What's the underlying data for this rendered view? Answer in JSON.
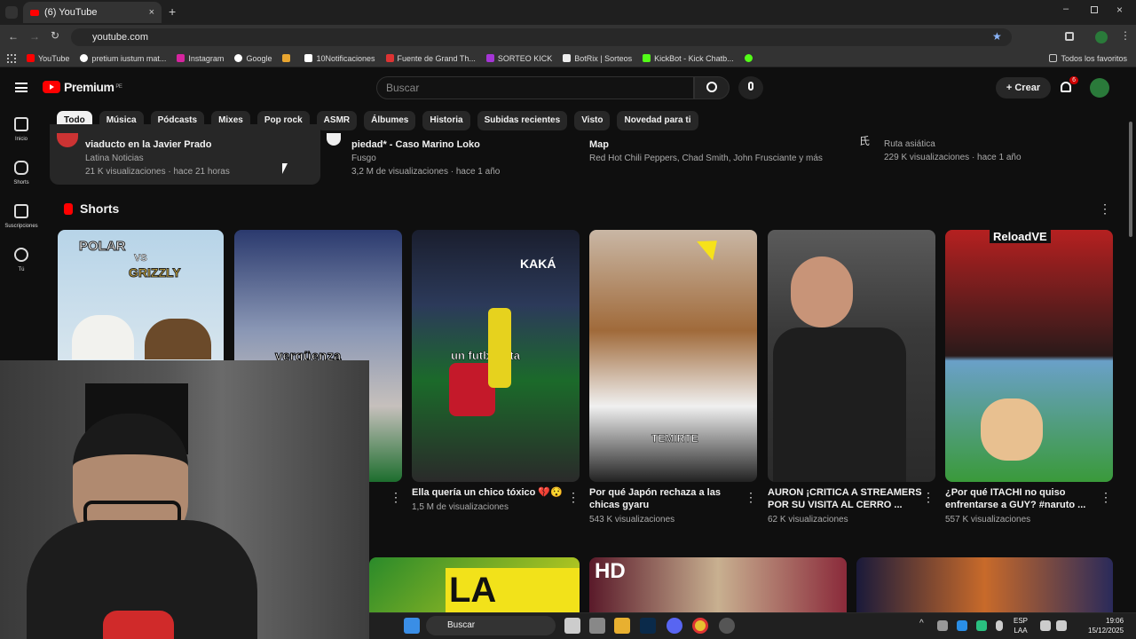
{
  "browser": {
    "tab_title": "(6) YouTube",
    "url": "youtube.com",
    "bookmarks": [
      "YouTube",
      "pretium iustum mat...",
      "Instagram",
      "Google",
      "",
      "10Notificaciones",
      "Fuente de Grand Th...",
      "SORTEO KICK",
      "BotRix | Sorteos",
      "KickBot - Kick Chatb...",
      "",
      ""
    ],
    "all_bookmarks": "Todos los favoritos"
  },
  "youtube": {
    "logo_text": "Premium",
    "logo_region": "PE",
    "search_placeholder": "Buscar",
    "create_label": "Crear",
    "notification_count": "6",
    "chips": [
      "Todo",
      "Música",
      "Pódcasts",
      "Mixes",
      "Pop rock",
      "ASMR",
      "Álbumes",
      "Historia",
      "Subidas recientes",
      "Visto",
      "Novedad para ti"
    ],
    "sidebar": [
      {
        "label": "Inicio",
        "icon": "home-icon"
      },
      {
        "label": "Shorts",
        "icon": "shorts-icon"
      },
      {
        "label": "Suscripciones",
        "icon": "subscriptions-icon"
      },
      {
        "label": "Tú",
        "icon": "user-icon"
      }
    ],
    "videos": [
      {
        "title": "viaducto en la Javier Prado",
        "channel": "Latina Noticias",
        "meta": "21 K visualizaciones · hace 21 horas"
      },
      {
        "title": "piedad* - Caso Marino Loko",
        "channel": "Fusgo",
        "meta": "3,2 M de visualizaciones · hace 1 año"
      },
      {
        "title": "Map",
        "channel": "Red Hot Chili Peppers, Chad Smith, John Frusciante y más",
        "meta": ""
      },
      {
        "title": "",
        "channel": "Ruta asiática",
        "meta": "229 K visualizaciones · hace 1 año"
      }
    ],
    "shorts_title": "Shorts",
    "shorts": [
      {
        "overlay": "POLAR",
        "overlay2": "VS",
        "overlay3": "GRIZZLY",
        "title": "",
        "views": ""
      },
      {
        "overlay": "vergüenza",
        "title": "",
        "views": ""
      },
      {
        "overlay": "KAKÁ",
        "overlay2": "un futbolista",
        "title": "Ella quería un chico tóxico 💔😯",
        "views": "1,5 M de visualizaciones"
      },
      {
        "overlay": "TEMIRTE",
        "title": "Por qué Japón rechaza a las chicas gyaru",
        "views": "543 K visualizaciones"
      },
      {
        "overlay": "",
        "title": "AURON ¡CRITICA A STREAMERS POR SU VISITA AL CERRO ...",
        "views": "62 K visualizaciones"
      },
      {
        "overlay": "ReloadVE",
        "title": "¿Por qué ITACHI no quiso enfrentarse a GUY? #naruto ...",
        "views": "557 K visualizaciones"
      }
    ],
    "bottom_thumbs": [
      "LA RAM",
      "HD",
      ""
    ]
  },
  "taskbar": {
    "search_label": "Buscar",
    "lang": "ESP",
    "lang2": "LAA",
    "time": "19:06",
    "date": "15/12/2025"
  }
}
